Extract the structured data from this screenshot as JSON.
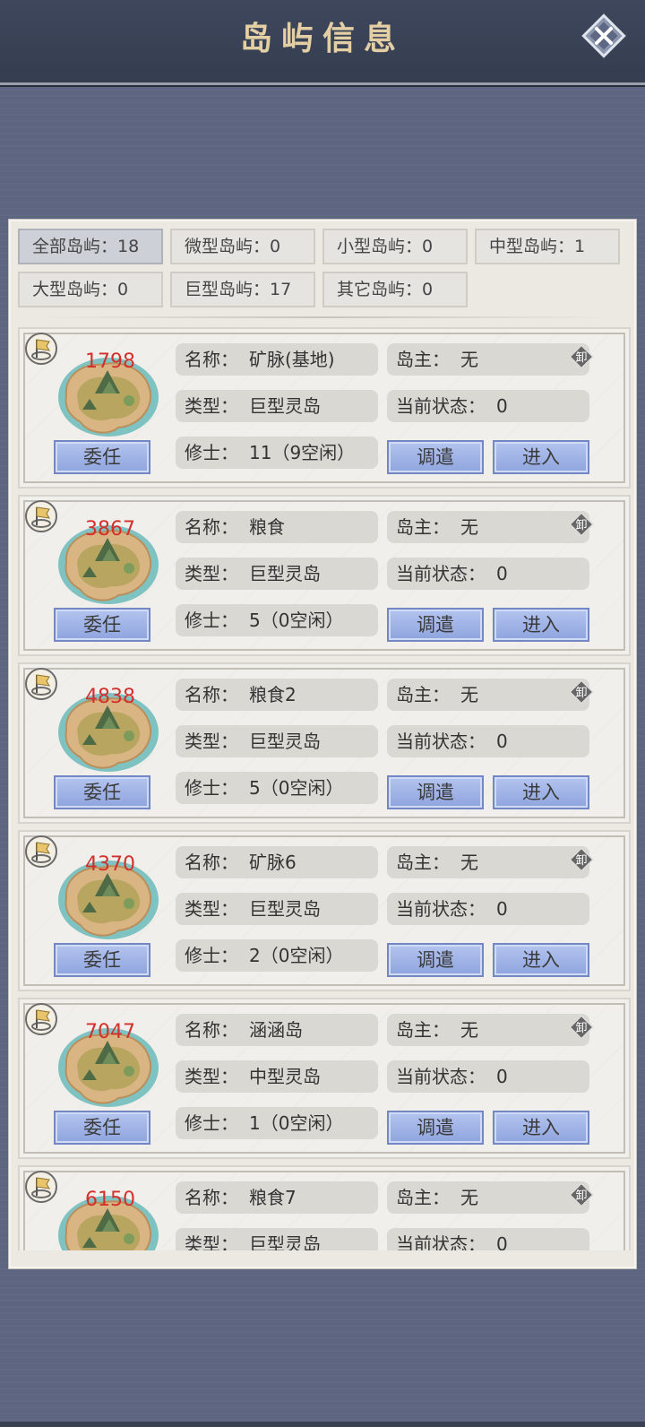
{
  "header": {
    "title": "岛屿信息"
  },
  "filters": [
    {
      "label": "全部岛屿：18",
      "active": true
    },
    {
      "label": "微型岛屿：0",
      "active": false
    },
    {
      "label": "小型岛屿：0",
      "active": false
    },
    {
      "label": "中型岛屿：1",
      "active": false
    },
    {
      "label": "大型岛屿：0",
      "active": false
    },
    {
      "label": "巨型岛屿：17",
      "active": false
    },
    {
      "label": "其它岛屿：0",
      "active": false
    }
  ],
  "labels": {
    "name_key": "名称：",
    "owner_key": "岛主：",
    "type_key": "类型：",
    "status_key": "当前状态：",
    "cultivator_key": "修士：",
    "appoint": "委任",
    "dispatch": "调遣",
    "enter": "进入",
    "unload": "卸"
  },
  "islands": [
    {
      "id": "1798",
      "name": "矿脉(基地)",
      "owner": "无",
      "type": "巨型灵岛",
      "status": "0",
      "cultivators": "11（9空闲）"
    },
    {
      "id": "3867",
      "name": "粮食",
      "owner": "无",
      "type": "巨型灵岛",
      "status": "0",
      "cultivators": "5（0空闲）"
    },
    {
      "id": "4838",
      "name": "粮食2",
      "owner": "无",
      "type": "巨型灵岛",
      "status": "0",
      "cultivators": "5（0空闲）"
    },
    {
      "id": "4370",
      "name": "矿脉6",
      "owner": "无",
      "type": "巨型灵岛",
      "status": "0",
      "cultivators": "2（0空闲）"
    },
    {
      "id": "7047",
      "name": "涵涵岛",
      "owner": "无",
      "type": "中型灵岛",
      "status": "0",
      "cultivators": "1（0空闲）"
    },
    {
      "id": "6150",
      "name": "粮食7",
      "owner": "无",
      "type": "巨型灵岛",
      "status": "0",
      "cultivators": ""
    }
  ]
}
